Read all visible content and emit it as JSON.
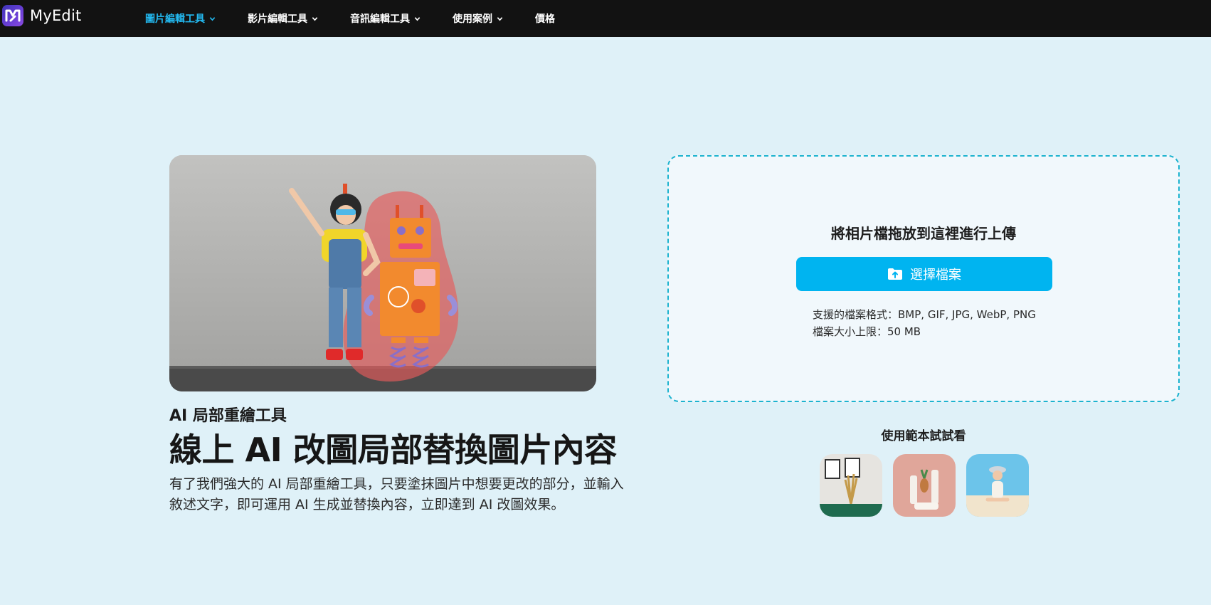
{
  "brand": {
    "name": "MyEdit"
  },
  "nav": {
    "items": [
      {
        "label": "圖片編輯工具",
        "active": true
      },
      {
        "label": "影片編輯工具",
        "active": false
      },
      {
        "label": "音訊編輯工具",
        "active": false
      },
      {
        "label": "使用案例",
        "active": false
      },
      {
        "label": "價格",
        "active": false
      }
    ]
  },
  "hero": {
    "eyebrow": "AI 局部重繪工具",
    "headline": "線上 AI 改圖局部替換圖片內容",
    "description": "有了我們強大的 AI 局部重繪工具，只要塗抹圖片中想要更改的部分，並輸入敘述文字，即可運用 AI 生成並替換內容，立即達到 AI 改圖效果。"
  },
  "upload": {
    "drop_text": "將相片檔拖放到這裡進行上傳",
    "button_label": "選擇檔案",
    "formats": "支援的檔案格式：BMP, GIF, JPG, WebP, PNG",
    "size_limit": "檔案大小上限：50 MB"
  },
  "samples": {
    "title": "使用範本試試看",
    "items": [
      "room-sample",
      "cosmetics-sample",
      "beach-sample"
    ]
  },
  "colors": {
    "accent": "#00b4f0",
    "nav_active": "#23b9f0",
    "background": "#dff1f8",
    "dashed_border": "#1cb3cf"
  }
}
